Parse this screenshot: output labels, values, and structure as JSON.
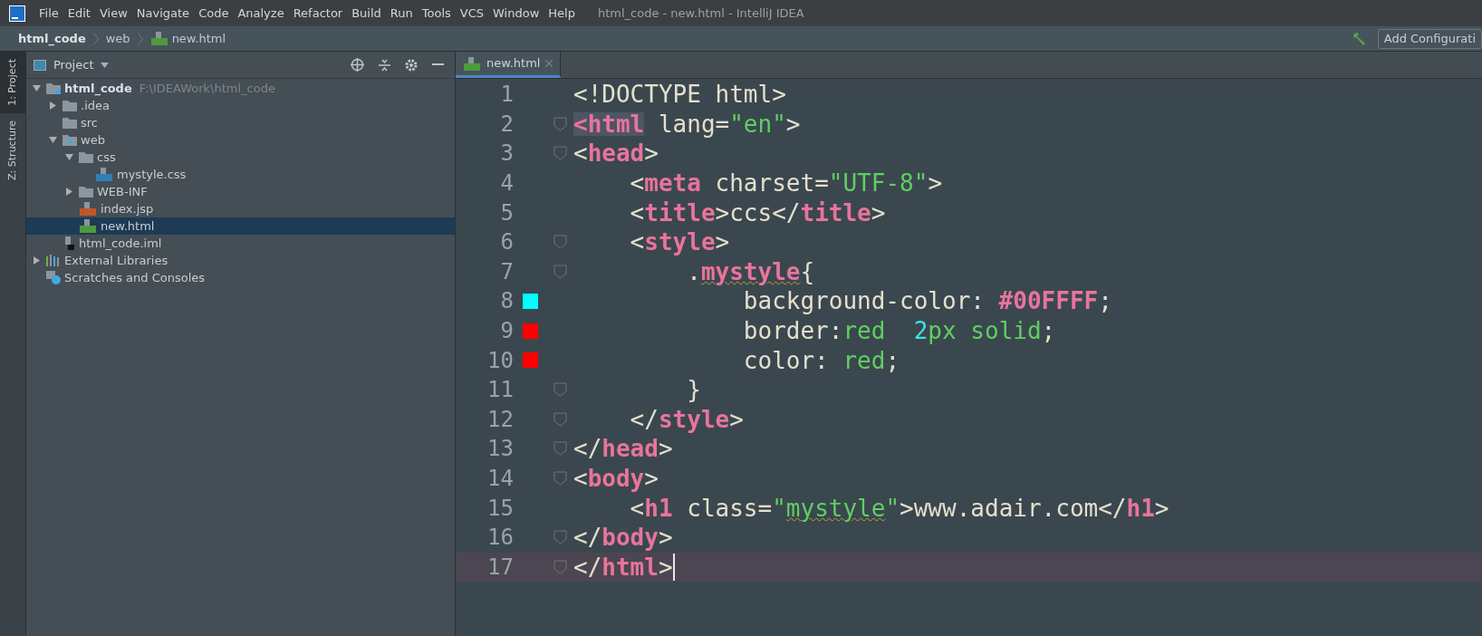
{
  "menu": [
    "File",
    "Edit",
    "View",
    "Navigate",
    "Code",
    "Analyze",
    "Refactor",
    "Build",
    "Run",
    "Tools",
    "VCS",
    "Window",
    "Help"
  ],
  "window": {
    "title": "html_code - new.html - IntelliJ IDEA"
  },
  "breadcrumbs": [
    {
      "label": "html_code",
      "kind": "project"
    },
    {
      "label": "web",
      "kind": "folder"
    },
    {
      "label": "new.html",
      "kind": "html"
    }
  ],
  "run_config": {
    "label": "Add Configurati"
  },
  "side_tabs": [
    {
      "label": "1: Project",
      "selected": true
    },
    {
      "label": "Z: Structure",
      "selected": false
    }
  ],
  "project_panel": {
    "title": "Project",
    "tree": [
      {
        "label": "html_code",
        "hint": "F:\\IDEAWork\\html_code",
        "kind": "module",
        "expanded": true,
        "selected": false,
        "children": [
          {
            "label": ".idea",
            "kind": "folder",
            "expanded": false,
            "selected": false
          },
          {
            "label": "src",
            "kind": "folder",
            "selected": false
          },
          {
            "label": "web",
            "kind": "web",
            "expanded": true,
            "selected": false,
            "children": [
              {
                "label": "css",
                "kind": "folder",
                "expanded": true,
                "selected": false,
                "children": [
                  {
                    "label": "mystyle.css",
                    "kind": "css",
                    "selected": false
                  }
                ]
              },
              {
                "label": "WEB-INF",
                "kind": "folder",
                "expanded": false,
                "selected": false
              },
              {
                "label": "index.jsp",
                "kind": "jsp",
                "selected": false
              },
              {
                "label": "new.html",
                "kind": "html",
                "selected": true
              }
            ]
          },
          {
            "label": "html_code.iml",
            "kind": "iml",
            "selected": false
          }
        ]
      },
      {
        "label": "External Libraries",
        "kind": "libraries",
        "expanded": false,
        "selected": false
      },
      {
        "label": "Scratches and Consoles",
        "kind": "scratches",
        "selected": false
      }
    ]
  },
  "editor_tabs": [
    {
      "label": "new.html",
      "selected": true
    }
  ],
  "code": [
    {
      "number": "1",
      "current": false,
      "fold": false,
      "tokens": [
        {
          "kind": "text",
          "t": "<!DOCTYPE html>"
        }
      ]
    },
    {
      "number": "2",
      "current": false,
      "fold": true,
      "tokens": [
        {
          "kind": "tag",
          "t": "<html",
          "mark": true
        },
        {
          "kind": "text",
          "t": " lang="
        },
        {
          "kind": "string",
          "t": "\"en\""
        },
        {
          "kind": "text",
          "t": ">"
        }
      ]
    },
    {
      "number": "3",
      "current": false,
      "fold": true,
      "tokens": [
        {
          "kind": "text",
          "t": "<"
        },
        {
          "kind": "tag",
          "t": "head"
        },
        {
          "kind": "text",
          "t": ">"
        }
      ]
    },
    {
      "number": "4",
      "current": false,
      "fold": false,
      "tokens": [
        {
          "kind": "text",
          "t": "    <"
        },
        {
          "kind": "tag",
          "t": "meta"
        },
        {
          "kind": "text",
          "t": " charset="
        },
        {
          "kind": "string",
          "t": "\"UTF-8\""
        },
        {
          "kind": "text",
          "t": ">"
        }
      ]
    },
    {
      "number": "5",
      "current": false,
      "fold": false,
      "tokens": [
        {
          "kind": "text",
          "t": "    <"
        },
        {
          "kind": "tag",
          "t": "title"
        },
        {
          "kind": "text",
          "t": ">ccs</"
        },
        {
          "kind": "tag",
          "t": "title"
        },
        {
          "kind": "text",
          "t": ">"
        }
      ]
    },
    {
      "number": "6",
      "current": false,
      "fold": true,
      "tokens": [
        {
          "kind": "text",
          "t": "    <"
        },
        {
          "kind": "tag",
          "t": "style"
        },
        {
          "kind": "text",
          "t": ">"
        }
      ]
    },
    {
      "number": "7",
      "current": false,
      "fold": true,
      "tokens": [
        {
          "kind": "text",
          "t": "        ."
        },
        {
          "kind": "tag",
          "t": "mystyle",
          "warn": true
        },
        {
          "kind": "text",
          "t": "{"
        }
      ]
    },
    {
      "number": "8",
      "current": false,
      "fold": false,
      "color": "#00ffff",
      "tokens": [
        {
          "kind": "text",
          "t": "            background-color: "
        },
        {
          "kind": "tag",
          "t": "#00FFFF"
        },
        {
          "kind": "text",
          "t": ";"
        }
      ]
    },
    {
      "number": "9",
      "current": false,
      "fold": false,
      "color": "#ff0000",
      "tokens": [
        {
          "kind": "text",
          "t": "            border:"
        },
        {
          "kind": "string",
          "t": "red  "
        },
        {
          "kind": "number",
          "t": "2"
        },
        {
          "kind": "string",
          "t": "px solid"
        },
        {
          "kind": "text",
          "t": ";"
        }
      ]
    },
    {
      "number": "10",
      "current": false,
      "fold": false,
      "color": "#ff0000",
      "tokens": [
        {
          "kind": "text",
          "t": "            color: "
        },
        {
          "kind": "string",
          "t": "red"
        },
        {
          "kind": "text",
          "t": ";"
        }
      ]
    },
    {
      "number": "11",
      "current": false,
      "fold": true,
      "tokens": [
        {
          "kind": "text",
          "t": "        }"
        }
      ]
    },
    {
      "number": "12",
      "current": false,
      "fold": true,
      "tokens": [
        {
          "kind": "text",
          "t": "    </"
        },
        {
          "kind": "tag",
          "t": "style"
        },
        {
          "kind": "text",
          "t": ">"
        }
      ]
    },
    {
      "number": "13",
      "current": false,
      "fold": true,
      "tokens": [
        {
          "kind": "text",
          "t": "</"
        },
        {
          "kind": "tag",
          "t": "head"
        },
        {
          "kind": "text",
          "t": ">"
        }
      ]
    },
    {
      "number": "14",
      "current": false,
      "fold": true,
      "tokens": [
        {
          "kind": "text",
          "t": "<"
        },
        {
          "kind": "tag",
          "t": "body"
        },
        {
          "kind": "text",
          "t": ">"
        }
      ]
    },
    {
      "number": "15",
      "current": false,
      "fold": false,
      "tokens": [
        {
          "kind": "text",
          "t": "    <"
        },
        {
          "kind": "tag",
          "t": "h1"
        },
        {
          "kind": "text",
          "t": " class="
        },
        {
          "kind": "string",
          "t": "\""
        },
        {
          "kind": "string",
          "t": "mystyle",
          "warn": true
        },
        {
          "kind": "string",
          "t": "\""
        },
        {
          "kind": "text",
          "t": ">www.adair.com</"
        },
        {
          "kind": "tag",
          "t": "h1"
        },
        {
          "kind": "text",
          "t": ">"
        }
      ]
    },
    {
      "number": "16",
      "current": false,
      "fold": true,
      "tokens": [
        {
          "kind": "text",
          "t": "</"
        },
        {
          "kind": "tag",
          "t": "body"
        },
        {
          "kind": "text",
          "t": ">"
        }
      ]
    },
    {
      "number": "17",
      "current": true,
      "fold": true,
      "tokens": [
        {
          "kind": "text",
          "t": "</"
        },
        {
          "kind": "tag",
          "t": "html"
        },
        {
          "kind": "text",
          "t": ">"
        }
      ]
    }
  ]
}
